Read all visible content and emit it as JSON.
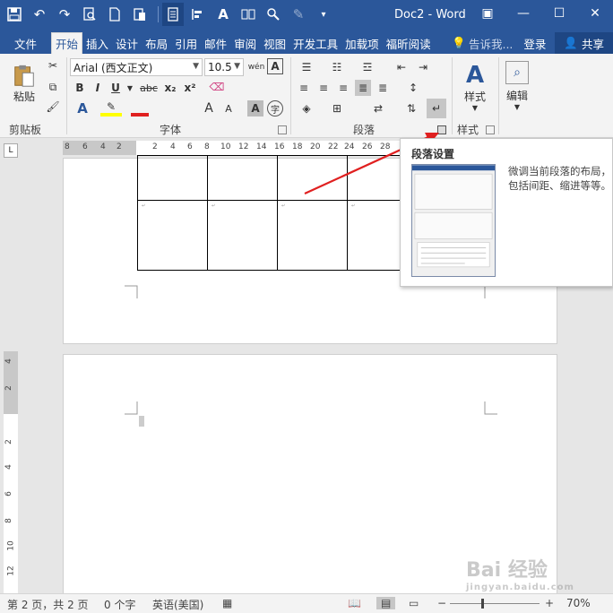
{
  "window": {
    "title": "Doc2 - Word"
  },
  "tabs": [
    "文件",
    "开始",
    "插入",
    "设计",
    "布局",
    "引用",
    "邮件",
    "审阅",
    "视图",
    "开发工具",
    "加载项",
    "福昕阅读"
  ],
  "tab_tail": {
    "tell_me": "告诉我...",
    "login": "登录",
    "share": "共享"
  },
  "ribbon": {
    "clipboard": {
      "paste": "粘贴",
      "label": "剪贴板"
    },
    "font": {
      "name": "Arial (西文正文)",
      "size": "10.5",
      "wen": "wén",
      "label": "字体",
      "bold": "B",
      "italic": "I",
      "underline": "U",
      "strike": "abc",
      "sub": "x₂",
      "sup": "x²",
      "grow": "A",
      "shrink": "A",
      "clear": "A",
      "char": "字"
    },
    "paragraph": {
      "label": "段落"
    },
    "styles": {
      "btn": "样式",
      "label": "样式"
    },
    "editing": {
      "btn": "编辑"
    }
  },
  "hruler_ticks": [
    "8",
    "6",
    "4",
    "2",
    "2",
    "4",
    "6",
    "8",
    "10",
    "12",
    "14",
    "16",
    "18",
    "20",
    "22",
    "24",
    "26",
    "28"
  ],
  "vruler_ticks": [
    "4",
    "2",
    "2",
    "4",
    "6",
    "8",
    "10",
    "12"
  ],
  "tooltip": {
    "title": "段落设置",
    "description": "微调当前段落的布局，包括间距、缩进等等。"
  },
  "status": {
    "page": "第 2 页，共 2 页",
    "words": "0 个字",
    "lang": "英语(美国)",
    "zoom": "70%"
  },
  "watermark": {
    "text": "Bai 经验",
    "sub": "jingyan.baidu.com"
  },
  "colors": {
    "accent": "#2b579a",
    "arrow": "#e02020"
  }
}
